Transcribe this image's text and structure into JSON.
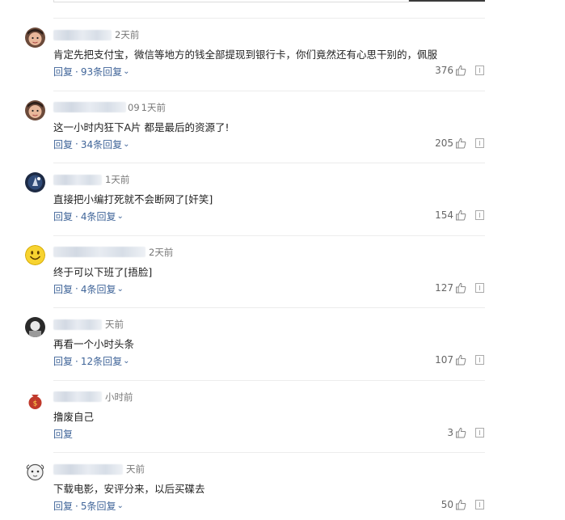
{
  "comments": [
    {
      "avatar_icon": "avatar-person-face-icon",
      "name_tail": "",
      "name_mask_width": 72,
      "time": "2天前",
      "content": "肯定先把支付宝，微信等地方的钱全部提现到银行卡，你们竟然还有心思干别的，佩服",
      "reply_label": "回复",
      "replies_label": "93条回复",
      "likes": "376"
    },
    {
      "avatar_icon": "avatar-person-face-icon",
      "name_tail": "09",
      "name_mask_width": 90,
      "time": "1天前",
      "content": "这一小时内狂下A片 都是最后的资源了!",
      "reply_label": "回复",
      "replies_label": "34条回复",
      "likes": "205"
    },
    {
      "avatar_icon": "avatar-dark-moon-icon",
      "name_tail": "",
      "name_mask_width": 60,
      "time": "1天前",
      "content": "直接把小编打死就不会断网了[奸笑]",
      "reply_label": "回复",
      "replies_label": "4条回复",
      "likes": "154"
    },
    {
      "avatar_icon": "avatar-smiley-icon",
      "name_tail": "",
      "name_mask_width": 114,
      "time": "2天前",
      "content": "终于可以下班了[捂脸]",
      "reply_label": "回复",
      "replies_label": "4条回复",
      "likes": "127"
    },
    {
      "avatar_icon": "avatar-dark-portrait-icon",
      "name_tail": "",
      "name_mask_width": 60,
      "time": "天前",
      "content": "再看一个小时头条",
      "reply_label": "回复",
      "replies_label": "12条回复",
      "likes": "107"
    },
    {
      "avatar_icon": "avatar-money-bag-icon",
      "name_tail": "",
      "name_mask_width": 60,
      "time": "小时前",
      "content": "撸废自己",
      "reply_label": "回复",
      "replies_label": "",
      "likes": "3"
    },
    {
      "avatar_icon": "avatar-cartoon-sheep-icon",
      "name_tail": "",
      "name_mask_width": 86,
      "time": "天前",
      "content": "下载电影，安评分来，以后买碟去",
      "reply_label": "回复",
      "replies_label": "5条回复",
      "likes": "50"
    }
  ],
  "colors": {
    "link": "#406599",
    "meta_text": "#777777",
    "divider": "#ececec"
  },
  "icons": {
    "like": "thumb-up-icon",
    "report": "report-icon",
    "expand": "chevron-down-icon"
  }
}
